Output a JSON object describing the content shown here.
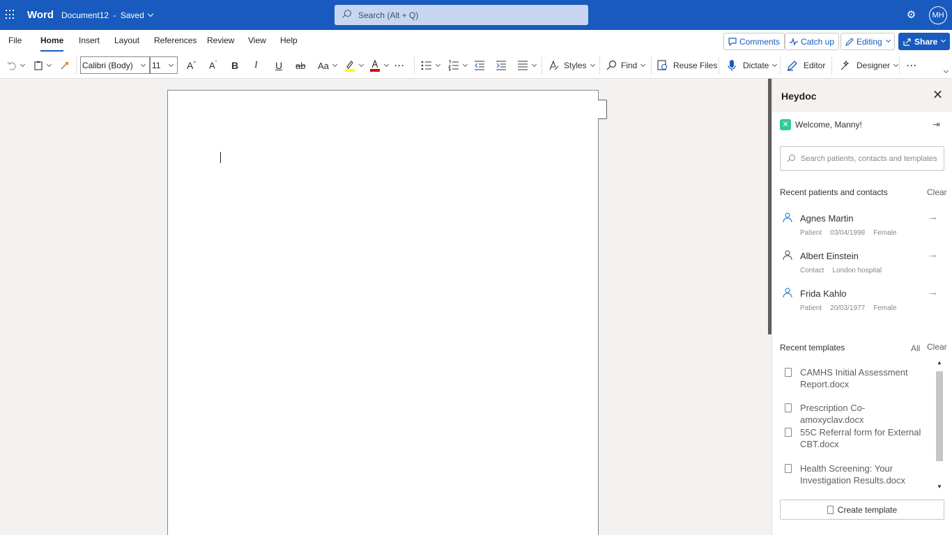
{
  "titlebar": {
    "app_name": "Word",
    "doc_name": "Document12",
    "separator": "-",
    "save_status": "Saved",
    "search_placeholder": "Search (Alt + Q)",
    "avatar_initials": "MH"
  },
  "menu": {
    "tabs": [
      "File",
      "Home",
      "Insert",
      "Layout",
      "References",
      "Review",
      "View",
      "Help"
    ],
    "active_tab": "Home",
    "buttons": {
      "comments": "Comments",
      "catch_up": "Catch up",
      "editing": "Editing",
      "share": "Share"
    }
  },
  "ribbon": {
    "font_name": "Calibri (Body)",
    "font_size": "11",
    "change_case": "Aa",
    "styles": "Styles",
    "find": "Find",
    "reuse_files": "Reuse Files",
    "dictate": "Dictate",
    "editor": "Editor",
    "designer": "Designer",
    "more": "···",
    "highlight_color": "#ffff00",
    "font_color": "#e00000"
  },
  "pane": {
    "title": "Heydoc",
    "welcome": "Welcome, Manny!",
    "search_placeholder": "Search patients, contacts and templates",
    "recent_contacts_label": "Recent patients and contacts",
    "clear": "Clear",
    "people": [
      {
        "name": "Agnes Martin",
        "type": "Patient",
        "detail1": "03/04/1998",
        "detail2": "Female",
        "icon_color": "#2b88d8"
      },
      {
        "name": "Albert Einstein",
        "type": "Contact",
        "detail1": "London hospital",
        "detail2": "",
        "icon_color": "#605e5c"
      },
      {
        "name": "Frida Kahlo",
        "type": "Patient",
        "detail1": "20/03/1977",
        "detail2": "Female",
        "icon_color": "#2b88d8"
      }
    ],
    "recent_templates_label": "Recent templates",
    "all": "All",
    "templates": [
      "CAMHS Initial Assessment Report.docx",
      "Prescription Co-amoxyclav.docx",
      "55C Referral form for External CBT.docx",
      "Health Screening: Your Investigation Results.docx"
    ],
    "create_template": "Create template",
    "brand_color": "#2ecc8f"
  },
  "colors": {
    "titlebar": "#185abd",
    "accent": "#185abd"
  }
}
